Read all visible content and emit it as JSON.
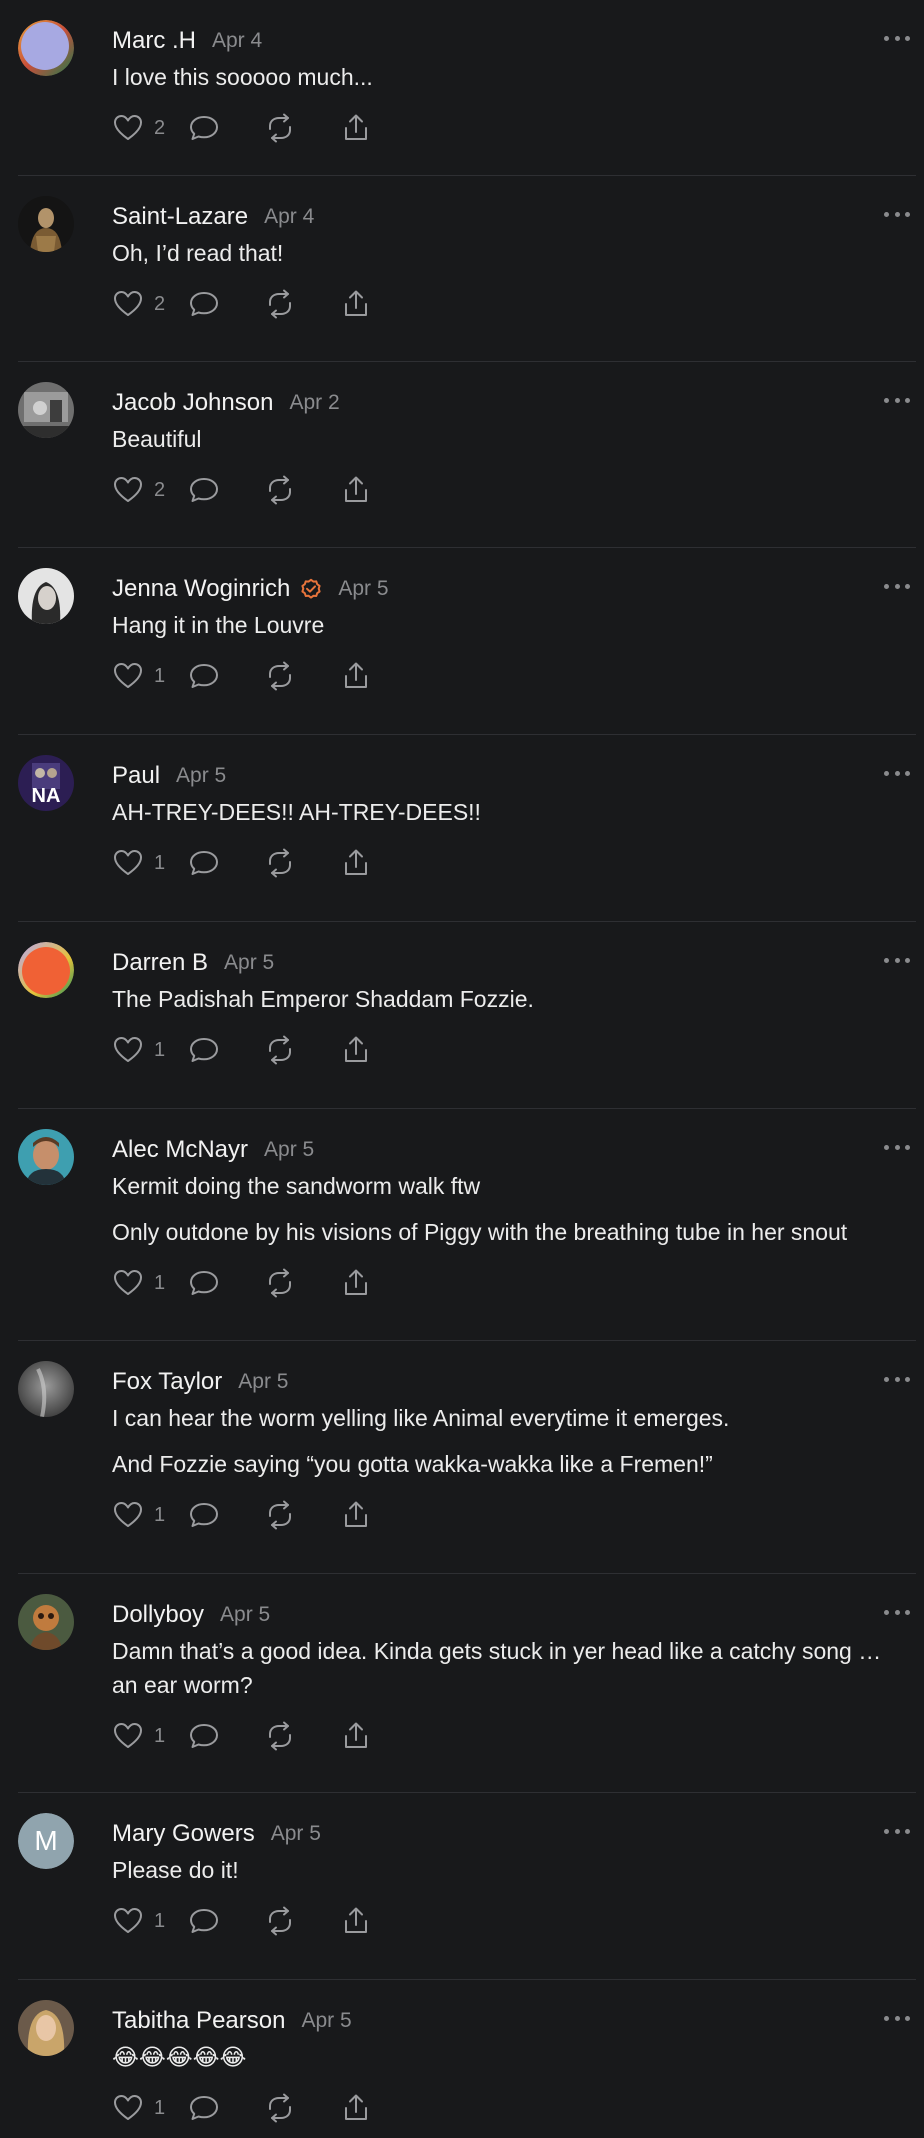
{
  "colors": {
    "background": "#18191b",
    "divider": "#2e2f33",
    "muted": "#8a8b8e",
    "verified": "#e8743b"
  },
  "comments": [
    {
      "author": "Marc .H",
      "date": "Apr 4",
      "lines": [
        "I love this sooooo much..."
      ],
      "likes": "2",
      "avatar": "gradient-blue-orange"
    },
    {
      "author": "Saint-Lazare",
      "date": "Apr 4",
      "lines": [
        "Oh, I’d read that!"
      ],
      "likes": "2",
      "avatar": "photo-dark"
    },
    {
      "author": "Jacob Johnson",
      "date": "Apr 2",
      "lines": [
        "Beautiful"
      ],
      "likes": "2",
      "avatar": "photo-gray"
    },
    {
      "author": "Jenna Woginrich",
      "date": "Apr 5",
      "lines": [
        "Hang it in the Louvre"
      ],
      "likes": "1",
      "verified": true,
      "avatar": "photo-light"
    },
    {
      "author": "Paul",
      "date": "Apr 5",
      "lines": [
        "AH-TREY-DEES!! AH-TREY-DEES!!"
      ],
      "likes": "1",
      "avatar": "photo-purple",
      "avatar_text": "NA"
    },
    {
      "author": "Darren B",
      "date": "Apr 5",
      "lines": [
        "The Padishah Emperor Shaddam Fozzie."
      ],
      "likes": "1",
      "avatar": "gradient-orange-green"
    },
    {
      "author": "Alec McNayr",
      "date": "Apr 5",
      "lines": [
        "Kermit doing the sandworm walk ftw",
        "Only outdone by his visions of Piggy with the breathing tube in her snout"
      ],
      "likes": "1",
      "avatar": "photo-teal"
    },
    {
      "author": "Fox Taylor",
      "date": "Apr 5",
      "lines": [
        "I can hear the worm yelling like Animal everytime it emerges.",
        "And Fozzie saying “you gotta wakka-wakka like a Fremen!”"
      ],
      "likes": "1",
      "avatar": "photo-smoke"
    },
    {
      "author": "Dollyboy",
      "date": "Apr 5",
      "lines": [
        "Damn that’s a good idea. Kinda gets stuck in yer head like a catchy song … an ear worm?"
      ],
      "wrap": true,
      "likes": "1",
      "avatar": "photo-brown"
    },
    {
      "author": "Mary Gowers",
      "date": "Apr 5",
      "lines": [
        "Please do it!"
      ],
      "likes": "1",
      "avatar": "letter",
      "avatar_text": "M"
    },
    {
      "author": "Tabitha Pearson",
      "date": "Apr 5",
      "lines": [
        "😂😂😂😂😂"
      ],
      "emoji": true,
      "likes": "1",
      "avatar": "photo-blonde"
    }
  ]
}
